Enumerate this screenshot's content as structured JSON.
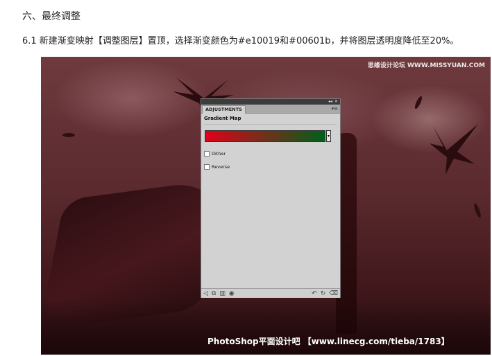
{
  "article": {
    "heading": "六、最终调整",
    "instruction": "6.1 新建渐变映射【调整图层】置顶，选择渐变颜色为#e10019和#00601b，并将图层透明度降低至20%。"
  },
  "photo": {
    "watermark_top": "思缘设计论坛 WWW.MISSYUAN.COM",
    "watermark_bottom": "PhotoShop平面设计吧 【www.linecg.com/tieba/1783】"
  },
  "panel": {
    "topbar_icons": [
      "collapse-icon",
      "close-icon"
    ],
    "tab_label": "ADJUSTMENTS",
    "menu_icon": "panel-menu-icon",
    "title": "Gradient Map",
    "gradient": {
      "start": "#e10019",
      "end": "#00601b"
    },
    "options": [
      {
        "label": "Dither",
        "checked": false
      },
      {
        "label": "Reverse",
        "checked": false
      }
    ],
    "bottom_icons_left": [
      "back-arrow-icon",
      "expand-view-icon",
      "clip-layer-icon",
      "eye-icon"
    ],
    "bottom_icons_right": [
      "previous-state-icon",
      "reset-icon",
      "trash-icon"
    ]
  }
}
